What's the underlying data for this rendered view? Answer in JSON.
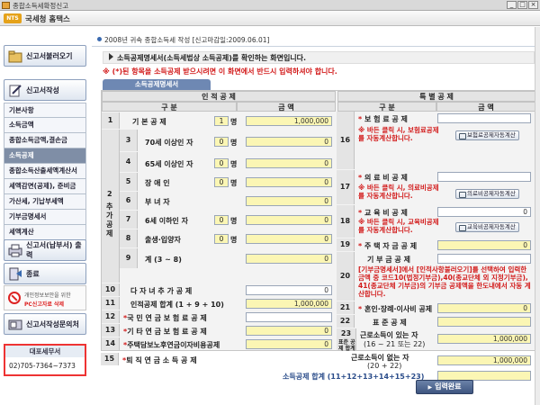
{
  "window": {
    "title": "종합소득세확정신고"
  },
  "logo": {
    "badge": "NTS",
    "text": "국세청 홈택스"
  },
  "sidebar": {
    "btn_load": "신고서불러오기",
    "btn_write": "신고서작성",
    "menu": [
      "기본사항",
      "소득금액",
      "종합소득금액,결손금",
      "소득공제",
      "종합소득산출세액계산서",
      "세액감면(공제), 준비금",
      "가산세, 기납부세액",
      "기부금명세서",
      "세액계산"
    ],
    "btn_pay": "신고서(납부서) 출력",
    "btn_exit": "종료",
    "notice_line1": "개인정보보안을 위한",
    "notice_line2": "PC신고자료 삭제",
    "btn_inquiry": "신고서작성문의처",
    "tax_office": "대포세무서",
    "tax_phone": "02)705-7364~7373"
  },
  "main": {
    "header": "2008년 귀속 종합소득세 작성 [신고마감일:2009.06.01]",
    "info1": "소득공제명세서(소득세법상 소득공제)를 확인하는 화면입니다.",
    "info2": "※ (*)된 항목을 소득공제 받으시려면 이 화면에서 반드시 입력하셔야 합니다.",
    "section_tab": "소득공제명세서",
    "left_header": "인 적 공 제",
    "right_header": "특 별 공 제",
    "col_gubun": "구 분",
    "col_amount": "금 액",
    "unit_person": "명",
    "rows_left": [
      {
        "no": "1",
        "label": "기 본 공 제",
        "count": "1",
        "amount": "1,000,000"
      },
      {
        "no": "3",
        "label": "70세 이상인 자",
        "count": "0",
        "amount": "0"
      },
      {
        "no": "4",
        "label": "65세 이상인 자",
        "count": "0",
        "amount": "0"
      },
      {
        "no": "5",
        "label": "장 애 인",
        "count": "0",
        "amount": "0"
      },
      {
        "no": "6",
        "label": "부 녀 자",
        "count": "",
        "amount": "0"
      },
      {
        "no": "7",
        "label": "6세 이하인 자",
        "count": "0",
        "amount": "0"
      },
      {
        "no": "8",
        "label": "출생·입양자",
        "count": "0",
        "amount": "0"
      },
      {
        "no": "9",
        "label": "계 (3 ~ 8)",
        "count": "",
        "amount": "0"
      },
      {
        "no": "10",
        "label": "다 자 녀 추 가 공 제",
        "count": "",
        "amount": "0"
      },
      {
        "no": "11",
        "label": "인적공제 합계 (1 + 9 + 10)",
        "count": "",
        "amount": "1,000,000"
      },
      {
        "no": "12",
        "label": "국 민 연 금 보 험 료 공 제",
        "count": "",
        "amount": ""
      },
      {
        "no": "13",
        "label": "기 타 연 금 보 험 료 공 제",
        "count": "",
        "amount": "0"
      },
      {
        "no": "14",
        "label": "주택담보노후연금이자비용공제",
        "count": "",
        "amount": "0"
      },
      {
        "no": "15",
        "label": "퇴 직 연 금 소 득 공 제",
        "count": "",
        "amount": "0"
      }
    ],
    "side_label_2": "2",
    "side_label_chuga": "추 가 공 제",
    "rows_right": {
      "r16_label": "보 험 료 공 제",
      "r16_note": "※ 바든 클릭 시, 보험료공제를 자동계산합니다.",
      "r16_btn": "보험료공제자동계산",
      "r17_label": "의 료 비 공 제",
      "r17_note": "※ 바든 클릭 시, 의료비공제를 자동계산합니다.",
      "r17_btn": "의료비공제자동계산",
      "r18_label": "교 육 비 공 제",
      "r18_note": "※ 바든 클릭 시, 교육비공제를 자동계산합니다.",
      "r18_btn": "교육비공제자동계산",
      "r18_amount": "0",
      "r19_label": "주 택 자 금 공 제",
      "r19_amount": "0",
      "r20_label": "기 부 금 공 제",
      "r20_note": "[기부금명세서]에서 [인적사항불러오기]를 선택하여 입력한 금액 중 코드10(법정기부금),40(종교단체 외 지정기부금), 41(종교단체 기부금)의 기부금 공제액을 한도내에서 자동 계산합니다.",
      "r21_label": "혼인·장례·이사비 공제",
      "r21_amount": "0",
      "r22_label": "표 준 공 제",
      "r23_label": "표준 공제 합계",
      "r23a_label": "근로소득이 있는 자",
      "r23a_sub": "(16 ~ 21 또는 22)",
      "r23a_amount": "1,000,000",
      "r23b_label": "근로소득이 없는 자",
      "r23b_sub": "(20 + 22)",
      "r23b_amount": "1,000,000"
    },
    "total_label": "소득공제 합계 (11+12+13+14+15+23)",
    "finish_btn": "입력완료"
  }
}
